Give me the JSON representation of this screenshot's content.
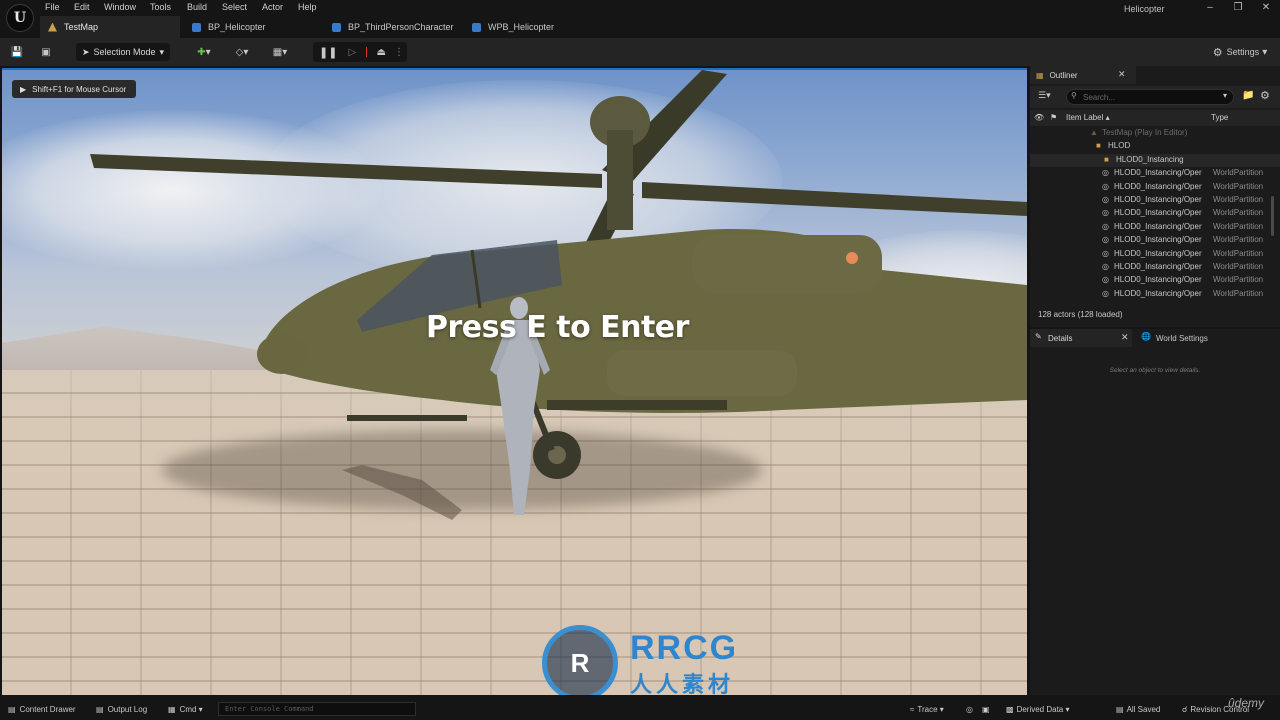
{
  "menu": {
    "items": [
      "File",
      "Edit",
      "Window",
      "Tools",
      "Build",
      "Select",
      "Actor",
      "Help"
    ],
    "window_title": "Helicopter"
  },
  "tabs": [
    {
      "label": "TestMap",
      "active": true,
      "icon": "level-icon"
    },
    {
      "label": "BP_Helicopter",
      "active": false,
      "icon": "blueprint-icon"
    },
    {
      "label": "BP_ThirdPersonCharacter",
      "active": false,
      "icon": "blueprint-icon"
    },
    {
      "label": "WPB_Helicopter",
      "active": false,
      "icon": "widget-blueprint-icon"
    }
  ],
  "toolbar": {
    "mode_label": "Selection Mode",
    "settings_label": "Settings"
  },
  "viewport": {
    "cursor_hint": "Shift+F1 for Mouse Cursor",
    "prompt_text": "Press E to Enter",
    "watermark_big": "RRCG",
    "watermark_small": "人人素材"
  },
  "outliner": {
    "tab_label": "Outliner",
    "search_placeholder": "Search...",
    "col_label": "Item Label",
    "col_type": "Type",
    "rows": [
      {
        "label": "TestMap (Play In Editor)",
        "type": "",
        "indent": 1,
        "dim": true
      },
      {
        "label": "HLOD",
        "type": "",
        "indent": 2,
        "dim": false
      },
      {
        "label": "HLOD0_Instancing",
        "type": "",
        "indent": 3,
        "dim": false
      },
      {
        "label": "HLOD0_Instancing/Oper",
        "type": "WorldPartition",
        "indent": 4,
        "dim": false
      },
      {
        "label": "HLOD0_Instancing/Oper",
        "type": "WorldPartition",
        "indent": 4,
        "dim": false
      },
      {
        "label": "HLOD0_Instancing/Oper",
        "type": "WorldPartition",
        "indent": 4,
        "dim": false
      },
      {
        "label": "HLOD0_Instancing/Oper",
        "type": "WorldPartition",
        "indent": 4,
        "dim": false
      },
      {
        "label": "HLOD0_Instancing/Oper",
        "type": "WorldPartition",
        "indent": 4,
        "dim": false
      },
      {
        "label": "HLOD0_Instancing/Oper",
        "type": "WorldPartition",
        "indent": 4,
        "dim": false
      },
      {
        "label": "HLOD0_Instancing/Oper",
        "type": "WorldPartition",
        "indent": 4,
        "dim": false
      },
      {
        "label": "HLOD0_Instancing/Oper",
        "type": "WorldPartition",
        "indent": 4,
        "dim": false
      },
      {
        "label": "HLOD0_Instancing/Oper",
        "type": "WorldPartition",
        "indent": 4,
        "dim": false
      },
      {
        "label": "HLOD0_Instancing/Oper",
        "type": "WorldPartition",
        "indent": 4,
        "dim": false
      }
    ],
    "actors_count": "128 actors (128 loaded)"
  },
  "details": {
    "tab_label": "Details",
    "world_settings_label": "World Settings",
    "empty_text": "Select an object to view details."
  },
  "statusbar": {
    "content_drawer": "Content Drawer",
    "output_log": "Output Log",
    "cmd": "Cmd",
    "console_placeholder": "Enter Console Command",
    "trace": "Trace",
    "derived_data": "Derived Data",
    "all_saved": "All Saved",
    "revision_control": "Revision Control"
  },
  "udemy_logo": "ûdemy",
  "colors": {
    "accent_blue": "#1b6fc8",
    "stop_red": "#e0302a",
    "folder_yellow": "#c9a14a",
    "panel_bg": "#1b1b1b",
    "toolbar_bg": "#242424"
  }
}
